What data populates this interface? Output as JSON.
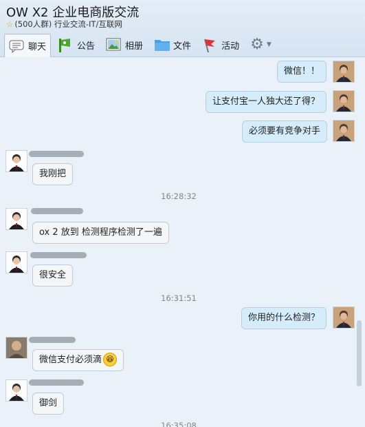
{
  "window": {
    "title": "OW X2 企业电商版交流",
    "subtitle": "(500人群) 行业交流-IT/互联网"
  },
  "toolbar": [
    {
      "label": "聊天",
      "icon": "chat-icon",
      "active": true
    },
    {
      "label": "公告",
      "icon": "announcement-icon"
    },
    {
      "label": "相册",
      "icon": "album-icon"
    },
    {
      "label": "文件",
      "icon": "folder-icon"
    },
    {
      "label": "活动",
      "icon": "flag-icon"
    }
  ],
  "messages": {
    "m1": "微信！！",
    "m2": "让支付宝一人独大还了得？",
    "m3": "必须要有竞争对手",
    "m4": "我刚把",
    "t1": "16:28:32",
    "m5": "ox 2 放到 检测程序检测了一遍",
    "m6": "很安全",
    "t2": "16:31:51",
    "m7": "你用的什么检测？",
    "m8": "微信支付必须滴",
    "m9": "御剑",
    "t3": "16:35:08"
  },
  "colors": {
    "outgoing_bubble": "#d5ecfa",
    "incoming_bubble": "#f4f6f8",
    "chat_background": "#eaf1f8"
  }
}
